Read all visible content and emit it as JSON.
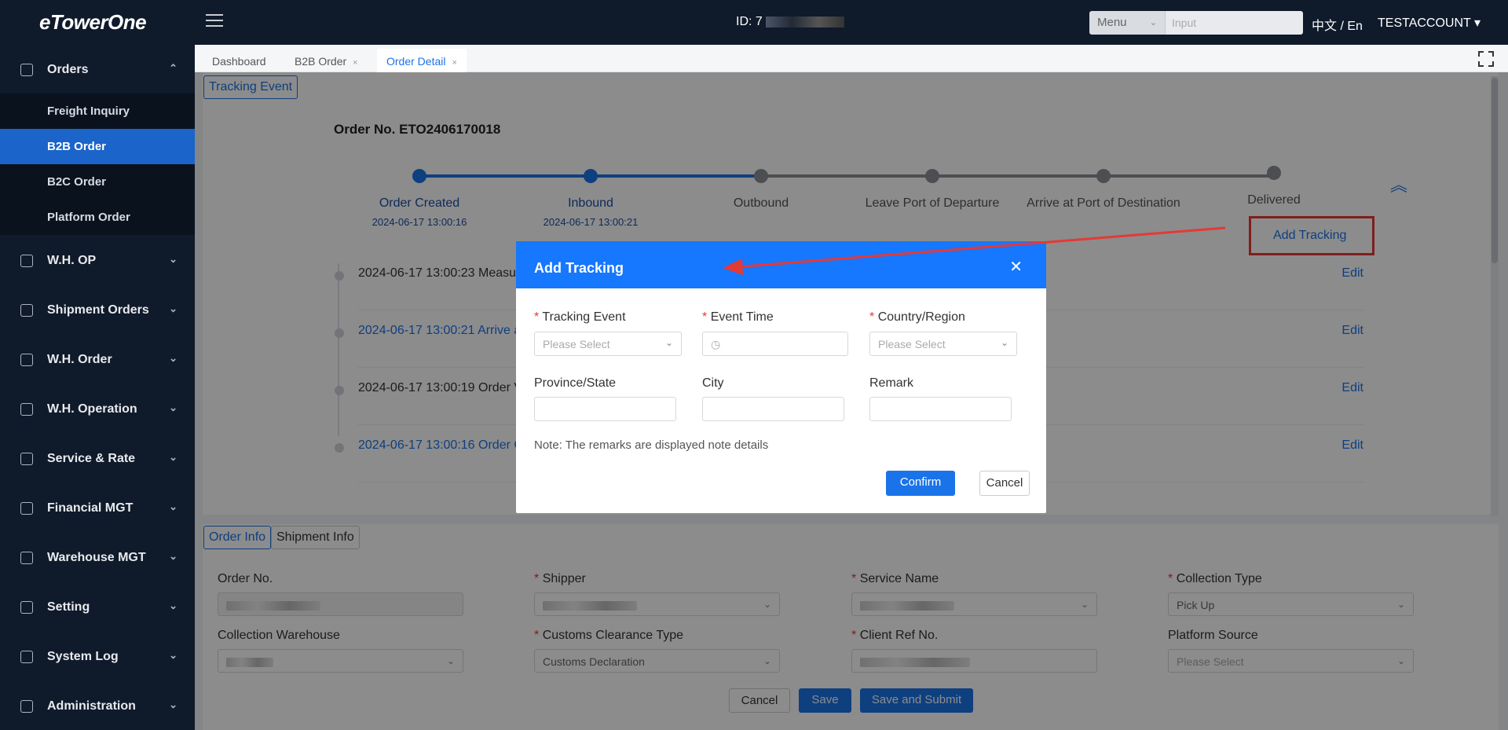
{
  "topbar": {
    "logo": "eTowerOne",
    "id_label": "ID: 7",
    "menu_select": "Menu",
    "input_placeholder": "Input",
    "lang": "中文 / En",
    "account": "TESTACCOUNT ▾"
  },
  "sidebar": {
    "groups": [
      {
        "label": "Orders",
        "icon": "orders-icon",
        "chev": "⌃"
      },
      {
        "label": "W.H. OP",
        "icon": "warehouse-op-icon",
        "chev": "⌄"
      },
      {
        "label": "Shipment Orders",
        "icon": "shipment-icon",
        "chev": "⌄"
      },
      {
        "label": "W.H. Order",
        "icon": "wh-order-icon",
        "chev": "⌄"
      },
      {
        "label": "W.H. Operation",
        "icon": "wh-operation-icon",
        "chev": "⌄"
      },
      {
        "label": "Service & Rate",
        "icon": "service-rate-icon",
        "chev": "⌄"
      },
      {
        "label": "Financial MGT",
        "icon": "financial-icon",
        "chev": "⌄"
      },
      {
        "label": "Warehouse MGT",
        "icon": "warehouse-mgt-icon",
        "chev": "⌄"
      },
      {
        "label": "Setting",
        "icon": "setting-icon",
        "chev": "⌄"
      },
      {
        "label": "System Log",
        "icon": "system-log-icon",
        "chev": "⌄"
      },
      {
        "label": "Administration",
        "icon": "admin-icon",
        "chev": "⌄"
      }
    ],
    "sub_items": [
      {
        "label": "Freight Inquiry"
      },
      {
        "label": "B2B Order"
      },
      {
        "label": "B2C Order"
      },
      {
        "label": "Platform Order"
      }
    ]
  },
  "tabs": [
    {
      "label": "Dashboard"
    },
    {
      "label": "B2B Order",
      "close": "×"
    },
    {
      "label": "Order Detail",
      "close": "×"
    }
  ],
  "tracking_chip": "Tracking Event",
  "order_no": "Order No. ETO2406170018",
  "steps": [
    {
      "label": "Order Created",
      "time": "2024-06-17 13:00:16"
    },
    {
      "label": "Inbound",
      "time": "2024-06-17 13:00:21"
    },
    {
      "label": "Outbound",
      "time": ""
    },
    {
      "label": "Leave Port of Departure",
      "time": ""
    },
    {
      "label": "Arrive at Port of Destination",
      "time": ""
    },
    {
      "label": "Delivered",
      "time": ""
    }
  ],
  "add_tracking": "Add Tracking",
  "timeline": [
    {
      "text": "2024-06-17 13:00:23 Measu",
      "edit": "Edit"
    },
    {
      "text": "2024-06-17 13:00:21 Arrive a",
      "edit": "Edit"
    },
    {
      "text": "2024-06-17 13:00:19 Order V",
      "edit": "Edit"
    },
    {
      "text": "2024-06-17 13:00:16 Order C",
      "edit": "Edit"
    }
  ],
  "info_tabs": {
    "order_info": "Order Info",
    "shipment_info": "Shipment Info"
  },
  "form": {
    "order_no": "Order No.",
    "shipper": "Shipper",
    "service_name": "Service Name",
    "collection_type": "Collection Type",
    "collection_type_value": "Pick Up",
    "collection_warehouse": "Collection Warehouse",
    "customs_type": "Customs Clearance Type",
    "customs_value": "Customs Declaration",
    "client_ref": "Client Ref No.",
    "platform_source": "Platform Source",
    "platform_placeholder": "Please Select",
    "req": "*"
  },
  "actions": {
    "cancel": "Cancel",
    "save": "Save",
    "save_submit": "Save and Submit"
  },
  "modal": {
    "title": "Add Tracking",
    "close": "✕",
    "tracking_event": "Tracking Event",
    "event_time": "Event Time",
    "country": "Country/Region",
    "province": "Province/State",
    "city": "City",
    "remark": "Remark",
    "select_placeholder": "Please Select",
    "clock": "◷",
    "note": "Note: The remarks are displayed note details",
    "confirm": "Confirm",
    "cancel": "Cancel",
    "req": "*"
  },
  "colors": {
    "primary": "#1677ff",
    "sidebar": "#0f1a2b",
    "annotation": "#e53935"
  }
}
